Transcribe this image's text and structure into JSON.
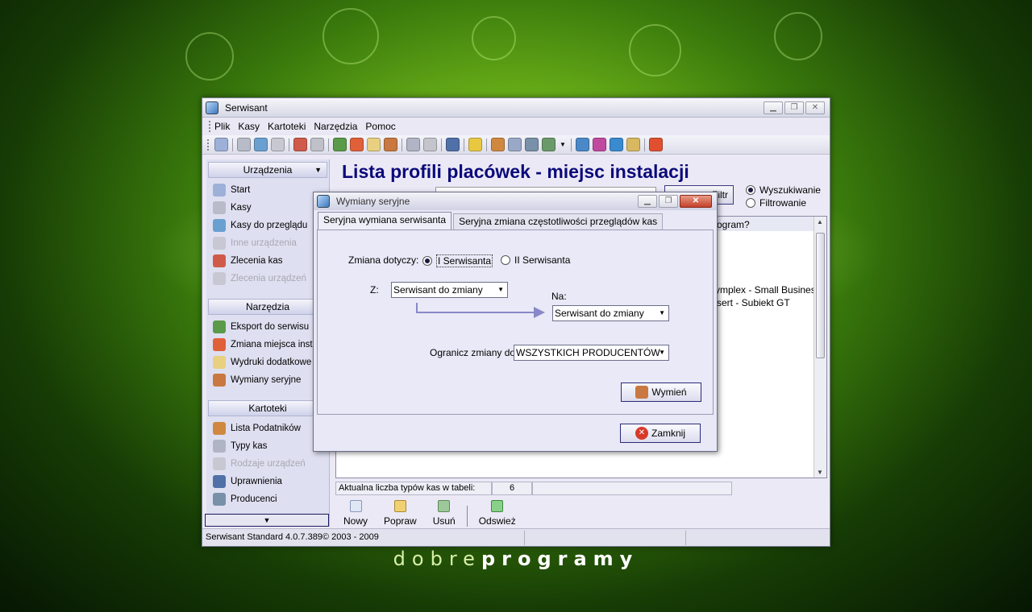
{
  "colors": {
    "heading": "#0a0a7a",
    "button_border": "#2a2a78"
  },
  "window": {
    "title": "Serwisant",
    "controls": [
      "minimize",
      "restore",
      "close"
    ]
  },
  "menu": [
    "Plik",
    "Kasy",
    "Kartoteki",
    "Narzędzia",
    "Pomoc"
  ],
  "sidebar": {
    "sections": [
      {
        "header": "Urządzenia",
        "items": [
          {
            "label": "Start",
            "icon": "house-icon",
            "enabled": true
          },
          {
            "label": "Kasy",
            "icon": "cash-register-icon",
            "enabled": true
          },
          {
            "label": "Kasy do przeglądu",
            "icon": "inspect-icon",
            "enabled": true
          },
          {
            "label": "Inne urządzenia",
            "icon": "devices-icon",
            "enabled": false
          },
          {
            "label": "Zlecenia kas",
            "icon": "order-icon",
            "enabled": true
          },
          {
            "label": "Zlecenia urządzeń",
            "icon": "device-order-icon",
            "enabled": false
          }
        ]
      },
      {
        "header": "Narzędzia",
        "items": [
          {
            "label": "Eksport do serwisu",
            "icon": "export-icon",
            "enabled": true
          },
          {
            "label": "Zmiana miejsca instal",
            "icon": "relocate-icon",
            "enabled": true
          },
          {
            "label": "Wydruki dodatkowe",
            "icon": "print-icon",
            "enabled": true
          },
          {
            "label": "Wymiany seryjne",
            "icon": "users-swap-icon",
            "enabled": true
          }
        ]
      },
      {
        "header": "Kartoteki",
        "items": [
          {
            "label": "Lista Podatników",
            "icon": "taxpayers-icon",
            "enabled": true
          },
          {
            "label": "Typy kas",
            "icon": "register-types-icon",
            "enabled": true
          },
          {
            "label": "Rodzaje urządzeń",
            "icon": "device-types-icon",
            "enabled": false
          },
          {
            "label": "Uprawnienia",
            "icon": "permissions-icon",
            "enabled": true
          },
          {
            "label": "Producenci",
            "icon": "producers-icon",
            "enabled": true
          }
        ]
      }
    ]
  },
  "main": {
    "heading": "Lista profili placówek - miejsc instalacji",
    "filter_button_label": "Filtr",
    "search_mode": {
      "options": [
        "Wyszukiwanie",
        "Filtrowanie"
      ],
      "selected": "Wyszukiwanie"
    },
    "grid_visible_text": [
      "ogram?",
      "ymplex - Small Business",
      "sert - Subiekt GT"
    ],
    "status_label": "Aktualna liczba typów kas w tabeli:",
    "status_count": "6",
    "bottom_toolbar": [
      "Nowy",
      "Popraw",
      "Usuń",
      "Odswież"
    ]
  },
  "statusbar": {
    "version": "Serwisant Standard 4.0.7.389© 2003 - 2009"
  },
  "dialog": {
    "title": "Wymiany seryjne",
    "tabs": [
      "Seryjna wymiana serwisanta",
      "Seryjna zmiana częstotliwości przeglądów kas"
    ],
    "active_tab": "Seryjna wymiana serwisanta",
    "zmiana_label": "Zmiana dotyczy:",
    "zmiana_options": [
      "I Serwisanta",
      "II Serwisanta"
    ],
    "zmiana_selected": "I Serwisanta",
    "z_label": "Z:",
    "z_value": "Serwisant do zmiany",
    "na_label": "Na:",
    "na_value": "Serwisant do zmiany",
    "ogranicz_label": "Ogranicz zmiany do:",
    "ogranicz_value": "WSZYSTKICH PRODUCENTÓW",
    "wymien_label": "Wymień",
    "zamknij_label": "Zamknij"
  },
  "watermark": {
    "part1": "dobre",
    "part2": "programy"
  }
}
